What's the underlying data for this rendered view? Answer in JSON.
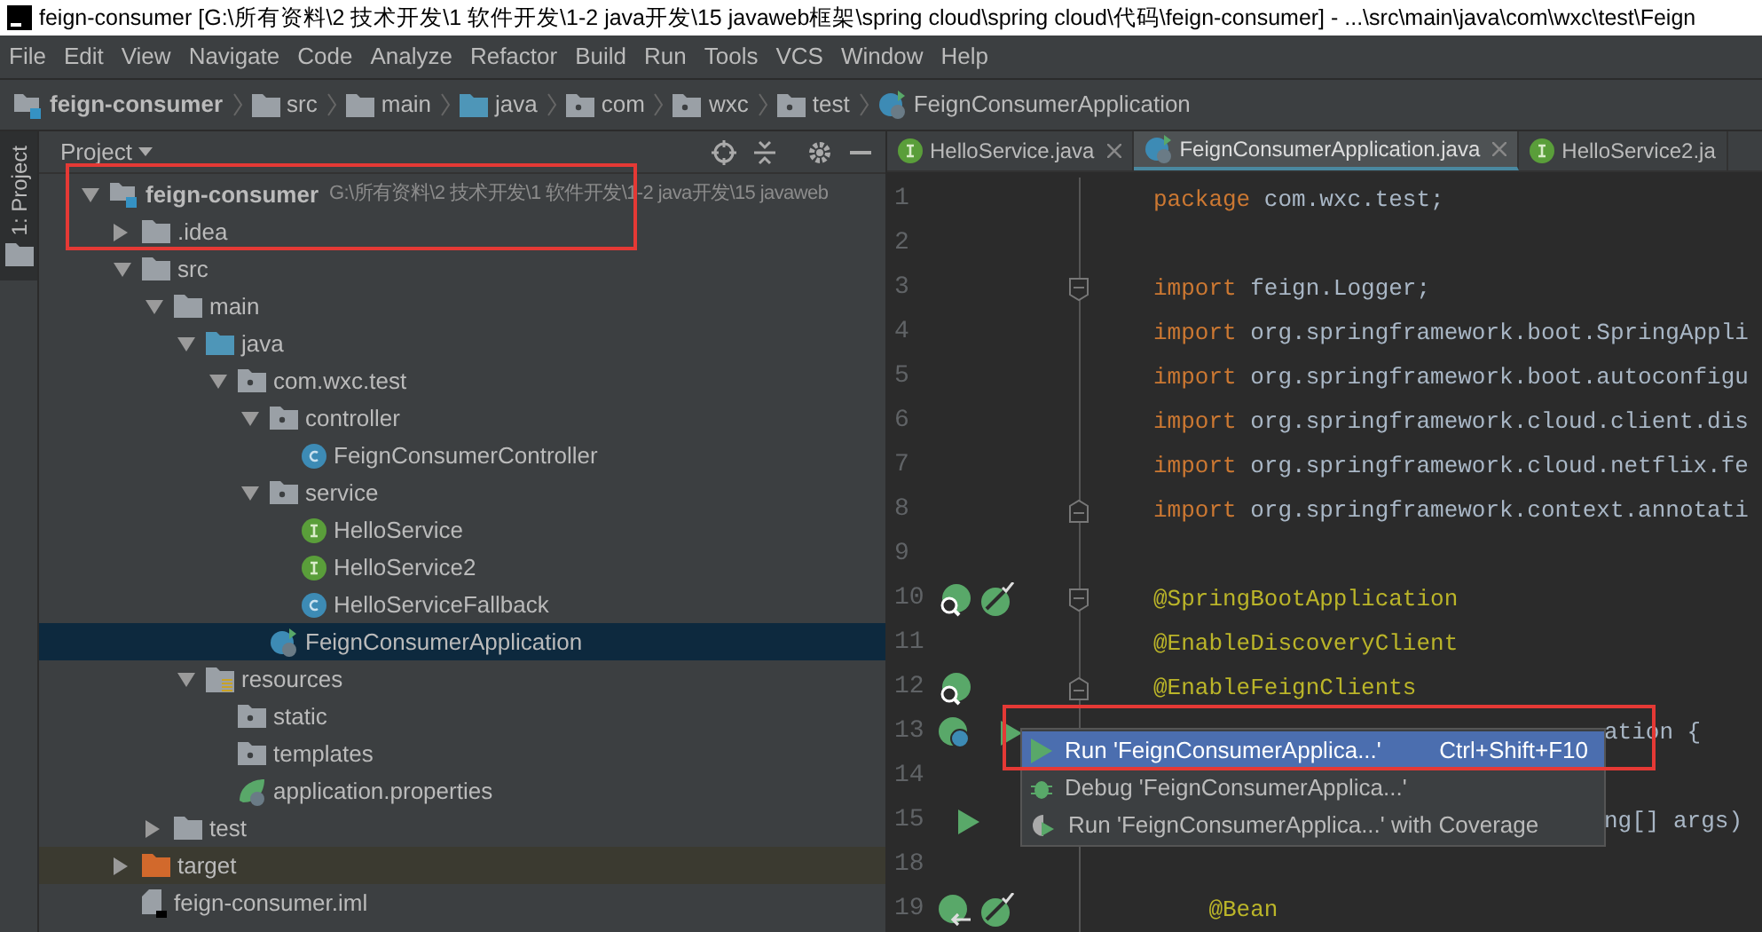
{
  "window": {
    "title": "feign-consumer [G:\\所有资料\\2 技术开发\\1 软件开发\\1-2 java开发\\15 javaweb框架\\spring cloud\\spring cloud\\代码\\feign-consumer] - ...\\src\\main\\java\\com\\wxc\\test\\Feign"
  },
  "menu": [
    "File",
    "Edit",
    "View",
    "Navigate",
    "Code",
    "Analyze",
    "Refactor",
    "Build",
    "Run",
    "Tools",
    "VCS",
    "Window",
    "Help"
  ],
  "breadcrumb": [
    {
      "label": "feign-consumer",
      "kind": "module"
    },
    {
      "label": "src",
      "kind": "folder"
    },
    {
      "label": "main",
      "kind": "folder"
    },
    {
      "label": "java",
      "kind": "source-folder"
    },
    {
      "label": "com",
      "kind": "package"
    },
    {
      "label": "wxc",
      "kind": "package"
    },
    {
      "label": "test",
      "kind": "package"
    },
    {
      "label": "FeignConsumerApplication",
      "kind": "spring-boot-class"
    }
  ],
  "side_strip": {
    "label": "1: Project",
    "selected": true
  },
  "project_panel": {
    "title": "Project",
    "tree": [
      {
        "label": "feign-consumer",
        "kind": "module",
        "path": "G:\\所有资料\\2 技术开发\\1 软件开发\\1-2 java开发\\15 javaweb",
        "expanded": true,
        "selected": false,
        "children": [
          {
            "label": ".idea",
            "kind": "folder",
            "expanded": false,
            "selected": false
          },
          {
            "label": "src",
            "kind": "folder",
            "expanded": true,
            "selected": false,
            "children": [
              {
                "label": "main",
                "kind": "folder",
                "expanded": true,
                "selected": false,
                "children": [
                  {
                    "label": "java",
                    "kind": "source-folder",
                    "expanded": true,
                    "selected": false,
                    "children": [
                      {
                        "label": "com.wxc.test",
                        "kind": "package",
                        "expanded": true,
                        "selected": false,
                        "children": [
                          {
                            "label": "controller",
                            "kind": "package",
                            "expanded": true,
                            "selected": false,
                            "children": [
                              {
                                "label": "FeignConsumerController",
                                "kind": "class",
                                "selected": false
                              }
                            ]
                          },
                          {
                            "label": "service",
                            "kind": "package",
                            "expanded": true,
                            "selected": false,
                            "children": [
                              {
                                "label": "HelloService",
                                "kind": "interface",
                                "selected": false
                              },
                              {
                                "label": "HelloService2",
                                "kind": "interface",
                                "selected": false
                              },
                              {
                                "label": "HelloServiceFallback",
                                "kind": "class",
                                "selected": false
                              }
                            ]
                          },
                          {
                            "label": "FeignConsumerApplication",
                            "kind": "spring-boot-class",
                            "selected": true
                          }
                        ]
                      }
                    ]
                  },
                  {
                    "label": "resources",
                    "kind": "resources-folder",
                    "expanded": true,
                    "selected": false,
                    "children": [
                      {
                        "label": "static",
                        "kind": "package",
                        "selected": false
                      },
                      {
                        "label": "templates",
                        "kind": "package",
                        "selected": false
                      },
                      {
                        "label": "application.properties",
                        "kind": "properties",
                        "selected": false
                      }
                    ]
                  }
                ]
              },
              {
                "label": "test",
                "kind": "folder",
                "expanded": false,
                "selected": false
              }
            ]
          },
          {
            "label": "target",
            "kind": "excluded-folder",
            "expanded": false,
            "selected": false
          },
          {
            "label": "feign-consumer.iml",
            "kind": "iml",
            "selected": false
          }
        ]
      }
    ]
  },
  "tabs": [
    {
      "label": "HelloService.java",
      "kind": "interface",
      "selected": false
    },
    {
      "label": "FeignConsumerApplication.java",
      "kind": "spring-boot-class",
      "selected": true
    },
    {
      "label": "HelloService2.ja",
      "kind": "interface",
      "selected": false
    }
  ],
  "code_lines": [
    {
      "number": "1",
      "tokens": [
        {
          "kind": "keyword",
          "text": "package"
        },
        {
          "kind": "plain",
          "text": " com.wxc.test;"
        }
      ]
    },
    {
      "number": "2"
    },
    {
      "number": "3",
      "fold_start": true,
      "tokens": [
        {
          "kind": "keyword",
          "text": "import"
        },
        {
          "kind": "plain",
          "text": " feign.Logger;"
        }
      ]
    },
    {
      "number": "4",
      "tokens": [
        {
          "kind": "keyword",
          "text": "import"
        },
        {
          "kind": "plain",
          "text": " org.springframework.boot.SpringAppli"
        }
      ]
    },
    {
      "number": "5",
      "tokens": [
        {
          "kind": "keyword",
          "text": "import"
        },
        {
          "kind": "plain",
          "text": " org.springframework.boot.autoconfigu"
        }
      ]
    },
    {
      "number": "6",
      "tokens": [
        {
          "kind": "keyword",
          "text": "import"
        },
        {
          "kind": "plain",
          "text": " org.springframework.cloud.client.dis"
        }
      ]
    },
    {
      "number": "7",
      "tokens": [
        {
          "kind": "keyword",
          "text": "import"
        },
        {
          "kind": "plain",
          "text": " org.springframework.cloud.netflix.fe"
        }
      ]
    },
    {
      "number": "8",
      "fold_end": true,
      "tokens": [
        {
          "kind": "keyword",
          "text": "import"
        },
        {
          "kind": "plain",
          "text": " org.springframework.context.annotati"
        }
      ]
    },
    {
      "number": "9"
    },
    {
      "number": "10",
      "fold_start": true,
      "gutter": [
        {
          "kind": "bean-search"
        },
        {
          "kind": "bean-check"
        }
      ],
      "tokens": [
        {
          "kind": "annotation",
          "text": "@SpringBootApplication"
        }
      ]
    },
    {
      "number": "11",
      "tokens": [
        {
          "kind": "annotation",
          "text": "@EnableDiscoveryClient"
        }
      ]
    },
    {
      "number": "12",
      "fold_end": true,
      "gutter": [
        {
          "kind": "bean-search"
        }
      ],
      "tokens": [
        {
          "kind": "annotation",
          "text": "@EnableFeignClients"
        }
      ]
    },
    {
      "number": "13",
      "gutter": [
        {
          "kind": "bean-class"
        },
        {
          "kind": "run"
        }
      ],
      "tokens": [
        {
          "kind": "tail",
          "text": "ation {"
        }
      ]
    },
    {
      "number": "14"
    },
    {
      "number": "15",
      "gutter": [
        {
          "kind": "run"
        }
      ],
      "tokens": [
        {
          "kind": "tail",
          "text": "ng[] args)"
        }
      ]
    },
    {
      "number": "18"
    },
    {
      "number": "19",
      "gutter": [
        {
          "kind": "bean-arrow"
        },
        {
          "kind": "bean-check"
        }
      ],
      "tokens": [
        {
          "kind": "annotation",
          "text": "    @Bean"
        }
      ]
    }
  ],
  "run_menu": [
    {
      "label": "Run 'FeignConsumerApplica...'",
      "shortcut": "Ctrl+Shift+F10",
      "kind": "run",
      "selected": true
    },
    {
      "label": "Debug 'FeignConsumerApplica...'",
      "kind": "debug",
      "selected": false
    },
    {
      "label": "Run 'FeignConsumerApplica...' with Coverage",
      "kind": "coverage",
      "selected": false
    }
  ],
  "annotations": {
    "tree_frame": true,
    "menu_frame": true
  }
}
